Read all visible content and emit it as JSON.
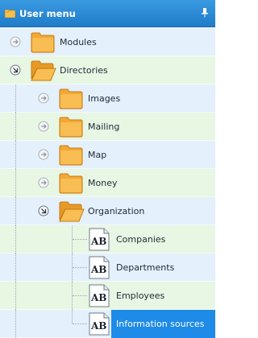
{
  "header": {
    "title": "User menu",
    "icon": "folder-icon",
    "pin_icon": "pin-icon",
    "bg_color": "#2a8bd6"
  },
  "tree": {
    "items": [
      {
        "label": "Modules",
        "icon": "folder-icon",
        "toggle": "expand-icon",
        "expanded": false
      },
      {
        "label": "Directories",
        "icon": "folder-open-icon",
        "toggle": "collapse-icon",
        "expanded": true
      },
      {
        "label": "Images",
        "icon": "folder-icon",
        "toggle": "expand-icon",
        "expanded": false
      },
      {
        "label": "Mailing",
        "icon": "folder-icon",
        "toggle": "expand-icon",
        "expanded": false
      },
      {
        "label": "Map",
        "icon": "folder-icon",
        "toggle": "expand-icon",
        "expanded": false
      },
      {
        "label": "Money",
        "icon": "folder-icon",
        "toggle": "expand-icon",
        "expanded": false
      },
      {
        "label": "Organization",
        "icon": "folder-open-icon",
        "toggle": "collapse-icon",
        "expanded": true
      },
      {
        "label": "Companies",
        "icon": "ab-document-icon",
        "icon_text": "AB"
      },
      {
        "label": "Departments",
        "icon": "ab-document-icon",
        "icon_text": "AB"
      },
      {
        "label": "Employees",
        "icon": "ab-document-icon",
        "icon_text": "AB"
      },
      {
        "label": "Information sources",
        "icon": "ab-document-icon",
        "icon_text": "AB",
        "selected": true
      }
    ]
  },
  "colors": {
    "row_blue": "#e4f0fb",
    "row_green": "#e8f6e4",
    "selected": "#1e8be8",
    "folder": "#f5b342"
  }
}
